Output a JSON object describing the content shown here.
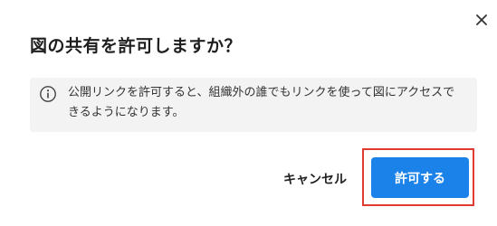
{
  "dialog": {
    "title": "図の共有を許可しますか？",
    "info_text": "公開リンクを許可すると、組織外の誰でもリンクを使って図にアクセスできるようになります。",
    "cancel_label": "キャンセル",
    "confirm_label": "許可する"
  },
  "icons": {
    "close": "close-icon",
    "info": "info-icon"
  },
  "colors": {
    "primary": "#1a82e8",
    "highlight": "#e43b30",
    "info_bg": "#f3f3f3"
  }
}
